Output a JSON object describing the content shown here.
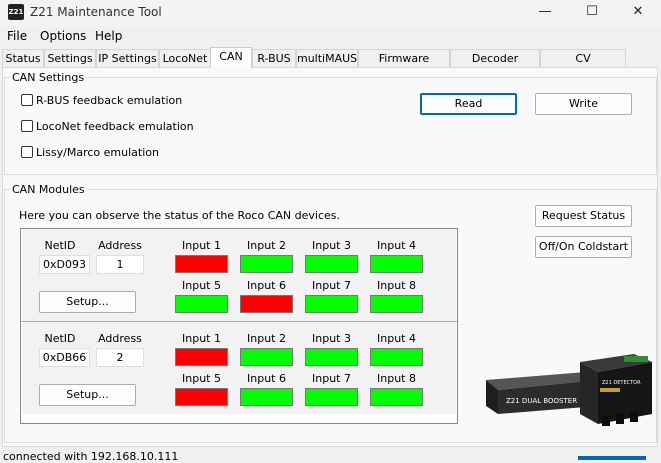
{
  "window": {
    "title": "Z21 Maintenance Tool",
    "icon_text": "Z21",
    "minimize": "—",
    "maximize": "☐",
    "close": "✕"
  },
  "menu": [
    "File",
    "Options",
    "Help"
  ],
  "tabs": [
    {
      "label": "Status"
    },
    {
      "label": "Settings"
    },
    {
      "label": "IP Settings"
    },
    {
      "label": "LocoNet"
    },
    {
      "label": "CAN",
      "active": true
    },
    {
      "label": "R-BUS"
    },
    {
      "label": "multiMAUS"
    },
    {
      "label": "Firmware update"
    },
    {
      "label": "Decoder update"
    },
    {
      "label": "CV Programming"
    }
  ],
  "can_settings": {
    "title": "CAN Settings",
    "options": [
      {
        "label": "R-BUS feedback emulation",
        "checked": false
      },
      {
        "label": "LocoNet feedback emulation",
        "checked": false
      },
      {
        "label": "Lissy/Marco emulation",
        "checked": false
      }
    ],
    "read_label": "Read",
    "write_label": "Write"
  },
  "can_modules": {
    "title": "CAN Modules",
    "description": "Here you can observe the status of the Roco CAN devices.",
    "request_status_label": "Request Status",
    "coldstart_label": "Off/On Coldstart",
    "netid_label": "NetID",
    "address_label": "Address",
    "setup_label": "Setup...",
    "colors": {
      "on": "#00ff00",
      "off": "#ff0000"
    },
    "modules": [
      {
        "netid": "0xD093",
        "address": "1",
        "inputs": [
          {
            "label": "Input 1",
            "state": "off"
          },
          {
            "label": "Input 2",
            "state": "on"
          },
          {
            "label": "Input 3",
            "state": "on"
          },
          {
            "label": "Input 4",
            "state": "on"
          },
          {
            "label": "Input 5",
            "state": "on"
          },
          {
            "label": "Input 6",
            "state": "off"
          },
          {
            "label": "Input 7",
            "state": "on"
          },
          {
            "label": "Input 8",
            "state": "on"
          }
        ]
      },
      {
        "netid": "0xDB66",
        "address": "2",
        "inputs": [
          {
            "label": "Input 1",
            "state": "off"
          },
          {
            "label": "Input 2",
            "state": "on"
          },
          {
            "label": "Input 3",
            "state": "on"
          },
          {
            "label": "Input 4",
            "state": "on"
          },
          {
            "label": "Input 5",
            "state": "off"
          },
          {
            "label": "Input 6",
            "state": "on"
          },
          {
            "label": "Input 7",
            "state": "on"
          },
          {
            "label": "Input 8",
            "state": "on"
          }
        ]
      }
    ]
  },
  "device_image": {
    "booster_label": "Z21 DUAL BOOSTER",
    "detector_label": "Z21 DETECTOR"
  },
  "status_bar": {
    "text": "connected with 192.168.10.111"
  }
}
